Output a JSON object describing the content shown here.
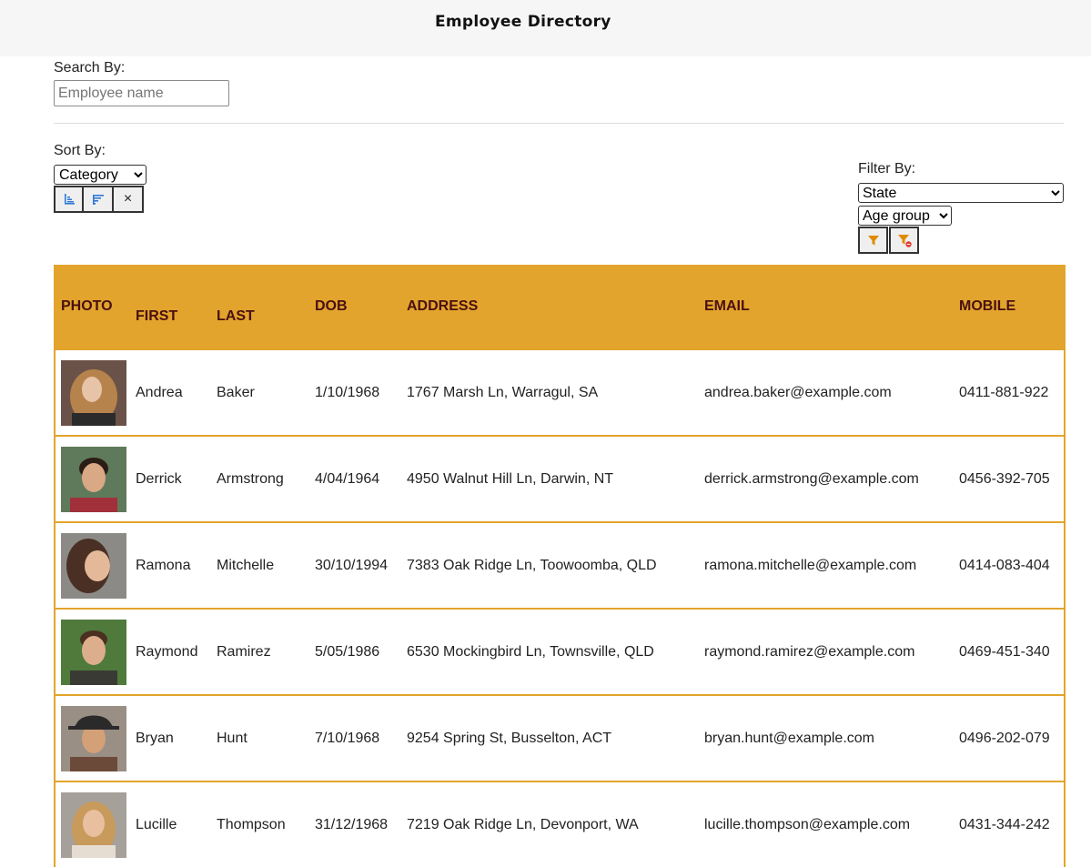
{
  "app": {
    "title": "Employee Directory"
  },
  "search": {
    "label": "Search By:",
    "placeholder": "Employee name",
    "value": ""
  },
  "sort": {
    "label": "Sort By:",
    "selected": "Category",
    "clear_label": "×"
  },
  "filter": {
    "label": "Filter By:",
    "state_selected": "State",
    "age_selected": "Age group"
  },
  "table": {
    "columns": [
      "PHOTO",
      "FIRST",
      "LAST",
      "DOB",
      "ADDRESS",
      "EMAIL",
      "MOBILE"
    ],
    "rows": [
      {
        "first": "Andrea",
        "last": "Baker",
        "dob": "1/10/1968",
        "address": "1767 Marsh Ln, Warragul, SA",
        "email": "andrea.baker@example.com",
        "mobile": "0411-881-922"
      },
      {
        "first": "Derrick",
        "last": "Armstrong",
        "dob": "4/04/1964",
        "address": "4950 Walnut Hill Ln, Darwin, NT",
        "email": "derrick.armstrong@example.com",
        "mobile": "0456-392-705"
      },
      {
        "first": "Ramona",
        "last": "Mitchelle",
        "dob": "30/10/1994",
        "address": "7383 Oak Ridge Ln, Toowoomba, QLD",
        "email": "ramona.mitchelle@example.com",
        "mobile": "0414-083-404"
      },
      {
        "first": "Raymond",
        "last": "Ramirez",
        "dob": "5/05/1986",
        "address": "6530 Mockingbird Ln, Townsville, QLD",
        "email": "raymond.ramirez@example.com",
        "mobile": "0469-451-340"
      },
      {
        "first": "Bryan",
        "last": "Hunt",
        "dob": "7/10/1968",
        "address": "9254 Spring St, Busselton, ACT",
        "email": "bryan.hunt@example.com",
        "mobile": "0496-202-079"
      },
      {
        "first": "Lucille",
        "last": "Thompson",
        "dob": "31/12/1968",
        "address": "7219 Oak Ridge Ln, Devonport, WA",
        "email": "lucille.thompson@example.com",
        "mobile": "0431-344-242"
      }
    ]
  },
  "colors": {
    "accent": "#e2a42c",
    "header_text": "#4a1010",
    "sort_icon": "#2f78d6",
    "filter_icon": "#e08a00",
    "clear_filter_badge": "#e53935"
  },
  "icons": {
    "sort_asc": "sort-ascending-icon",
    "sort_desc": "sort-descending-icon",
    "filter": "filter-icon",
    "clear_filter": "clear-filter-icon"
  }
}
